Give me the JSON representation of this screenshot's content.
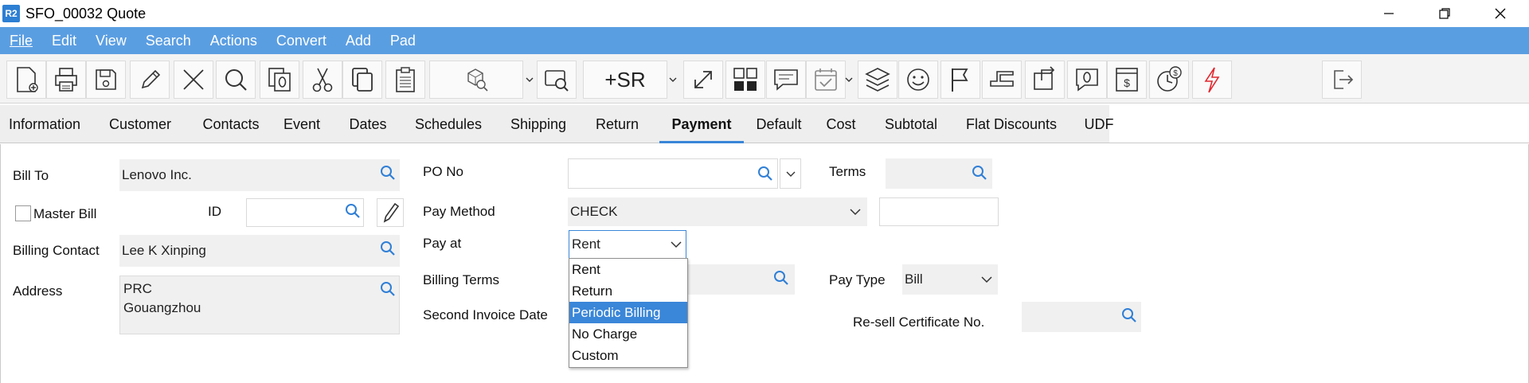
{
  "window": {
    "logo": "R2",
    "title": "SFO_00032 Quote"
  },
  "menu": [
    "File",
    "Edit",
    "View",
    "Search",
    "Actions",
    "Convert",
    "Add",
    "Pad"
  ],
  "toolbar": {
    "add_sr_label": "+SR"
  },
  "tabs": [
    "Information",
    "Customer",
    "Contacts",
    "Event",
    "Dates",
    "Schedules",
    "Shipping",
    "Return",
    "Payment",
    "Default",
    "Cost",
    "Subtotal",
    "Flat Discounts",
    "UDF"
  ],
  "active_tab": "Payment",
  "form": {
    "bill_to_label": "Bill To",
    "bill_to_value": "Lenovo Inc.",
    "master_bill_label": "Master Bill",
    "id_label": "ID",
    "id_value": "",
    "billing_contact_label": "Billing Contact",
    "billing_contact_value": "Lee K Xinping",
    "address_label": "Address",
    "address_line1": "PRC",
    "address_line2": "Gouangzhou",
    "po_no_label": "PO No",
    "po_no_value": "",
    "terms_label": "Terms",
    "terms_value": "",
    "pay_method_label": "Pay Method",
    "pay_method_value": "CHECK",
    "pay_method_extra": "",
    "pay_at_label": "Pay at",
    "pay_at_value": "Rent",
    "billing_terms_label": "Billing Terms",
    "pay_type_label": "Pay Type",
    "pay_type_value": "Bill",
    "second_invoice_date_label": "Second Invoice Date",
    "resell_cert_label": "Re-sell Certificate No.",
    "resell_cert_value": ""
  },
  "pay_at_options": [
    "Rent",
    "Return",
    "Periodic Billing",
    "No Charge",
    "Custom"
  ],
  "pay_at_highlighted": "Periodic Billing",
  "colors": {
    "menu_bar": "#5a9ee2",
    "accent": "#3a86d8",
    "magnifier": "#2f7fd6",
    "lightning": "#e0282e"
  }
}
